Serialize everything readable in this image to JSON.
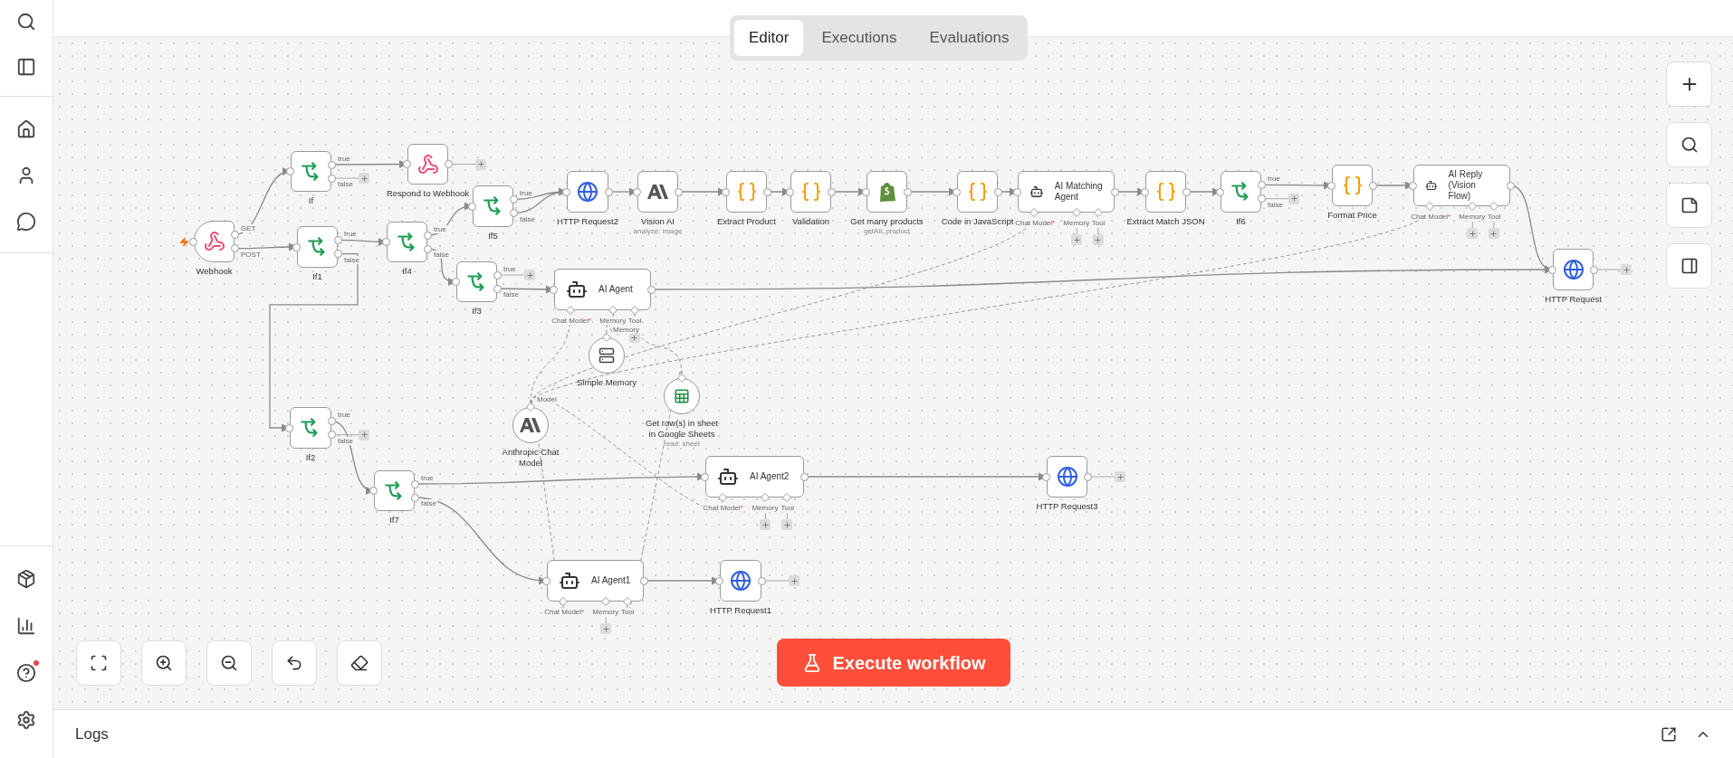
{
  "sidebar": {
    "help_badge": true
  },
  "tabs": [
    {
      "label": "Editor",
      "selected": true
    },
    {
      "label": "Executions",
      "selected": false
    },
    {
      "label": "Evaluations",
      "selected": false
    }
  ],
  "workflow": {
    "nodes": [
      {
        "kind": "webhook",
        "label": "Webhook",
        "trigger": true,
        "outputs": [
          "GET",
          "POST"
        ]
      },
      {
        "kind": "if",
        "label": "If",
        "outputs": [
          "true",
          "false"
        ]
      },
      {
        "kind": "webhook",
        "label": "Respond to Webhook"
      },
      {
        "kind": "if",
        "label": "If1",
        "outputs": [
          "true",
          "false"
        ]
      },
      {
        "kind": "if",
        "label": "If4",
        "outputs": [
          "true",
          "false"
        ]
      },
      {
        "kind": "if",
        "label": "If5",
        "outputs": [
          "true",
          "false"
        ]
      },
      {
        "kind": "if",
        "label": "If3",
        "outputs": [
          "true",
          "false"
        ]
      },
      {
        "kind": "http",
        "label": "HTTP Request2"
      },
      {
        "kind": "anthropic",
        "label": "Vision AI",
        "subtitle": "analyze: image"
      },
      {
        "kind": "code",
        "label": "Extract Product"
      },
      {
        "kind": "code",
        "label": "Validation"
      },
      {
        "kind": "shopify",
        "label": "Get many products",
        "subtitle": "getAll: product"
      },
      {
        "kind": "code",
        "label": "Code in JavaScript"
      },
      {
        "kind": "agent",
        "label": "AI Matching Agent",
        "ports": [
          {
            "label": "Chat Model",
            "mark": "*"
          },
          {
            "label": "Memory"
          },
          {
            "label": "Tool"
          }
        ]
      },
      {
        "kind": "code",
        "label": "Extract Match JSON"
      },
      {
        "kind": "if",
        "label": "If6",
        "outputs": [
          "true",
          "false"
        ]
      },
      {
        "kind": "code",
        "label": "Format Price"
      },
      {
        "kind": "agent",
        "label": "AI Reply (Vision Flow)",
        "ports": [
          {
            "label": "Chat Model",
            "mark": "*"
          },
          {
            "label": "Memory"
          },
          {
            "label": "Tool"
          }
        ]
      },
      {
        "kind": "agent",
        "label": "AI Agent",
        "ports": [
          {
            "label": "Chat Model",
            "mark": "*"
          },
          {
            "label": "Memory"
          },
          {
            "label": "Tool"
          }
        ]
      },
      {
        "kind": "http",
        "label": "HTTP Request"
      },
      {
        "kind": "memory",
        "label": "Simple Memory",
        "input_label": "Memory"
      },
      {
        "kind": "chat_model",
        "label": "Anthropic Chat Model",
        "input_label": "Model"
      },
      {
        "kind": "sheets",
        "label": "Get row(s) in sheet in Google Sheets",
        "subtitle": "read: sheet"
      },
      {
        "kind": "if",
        "label": "If2",
        "outputs": [
          "true",
          "false"
        ]
      },
      {
        "kind": "if",
        "label": "If7",
        "outputs": [
          "true",
          "false"
        ]
      },
      {
        "kind": "agent",
        "label": "AI Agent2",
        "ports": [
          {
            "label": "Chat Model",
            "mark": "*"
          },
          {
            "label": "Memory"
          },
          {
            "label": "Tool"
          }
        ]
      },
      {
        "kind": "http",
        "label": "HTTP Request3"
      },
      {
        "kind": "agent",
        "label": "AI Agent1",
        "ports": [
          {
            "label": "Chat Model",
            "mark": "*"
          },
          {
            "label": "Memory"
          },
          {
            "label": "Tool"
          }
        ]
      },
      {
        "kind": "http",
        "label": "HTTP Request1"
      }
    ]
  },
  "execute_button": {
    "label": "Execute workflow"
  },
  "logs": {
    "title": "Logs"
  }
}
